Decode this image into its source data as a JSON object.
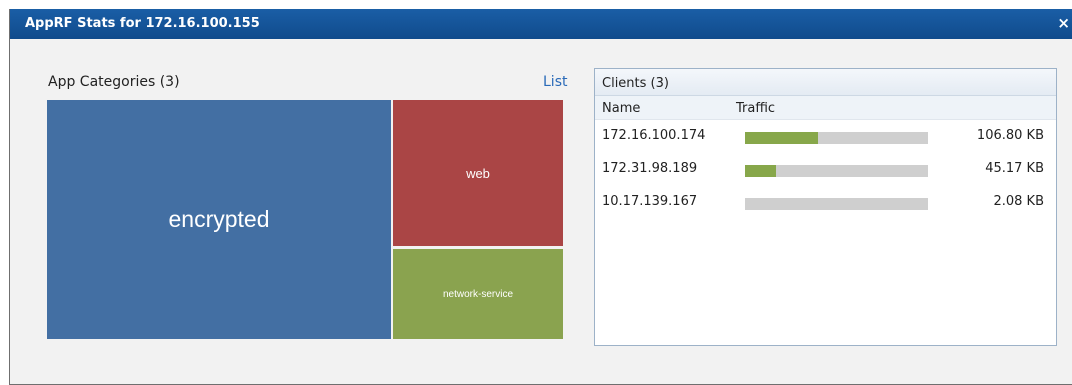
{
  "dialog": {
    "title": "AppRF Stats for 172.16.100.155",
    "close_label": "×"
  },
  "categories": {
    "title": "App Categories (3)",
    "list_link": "List",
    "tiles": [
      {
        "label": "encrypted",
        "color": "#436fa3"
      },
      {
        "label": "web",
        "color": "#aa4545"
      },
      {
        "label": "network-service",
        "color": "#8aa34f"
      }
    ]
  },
  "clients": {
    "title": "Clients (3)",
    "columns": [
      "Name",
      "Traffic"
    ],
    "rows": [
      {
        "ip": "172.16.100.174",
        "size": "106.80 KB",
        "fraction": 0.4
      },
      {
        "ip": "172.31.98.189",
        "size": "45.17 KB",
        "fraction": 0.17
      },
      {
        "ip": "10.17.139.167",
        "size": "2.08 KB",
        "fraction": 0.0
      }
    ],
    "bar_color": "#87a74a",
    "track_color": "#cfcfcf"
  }
}
